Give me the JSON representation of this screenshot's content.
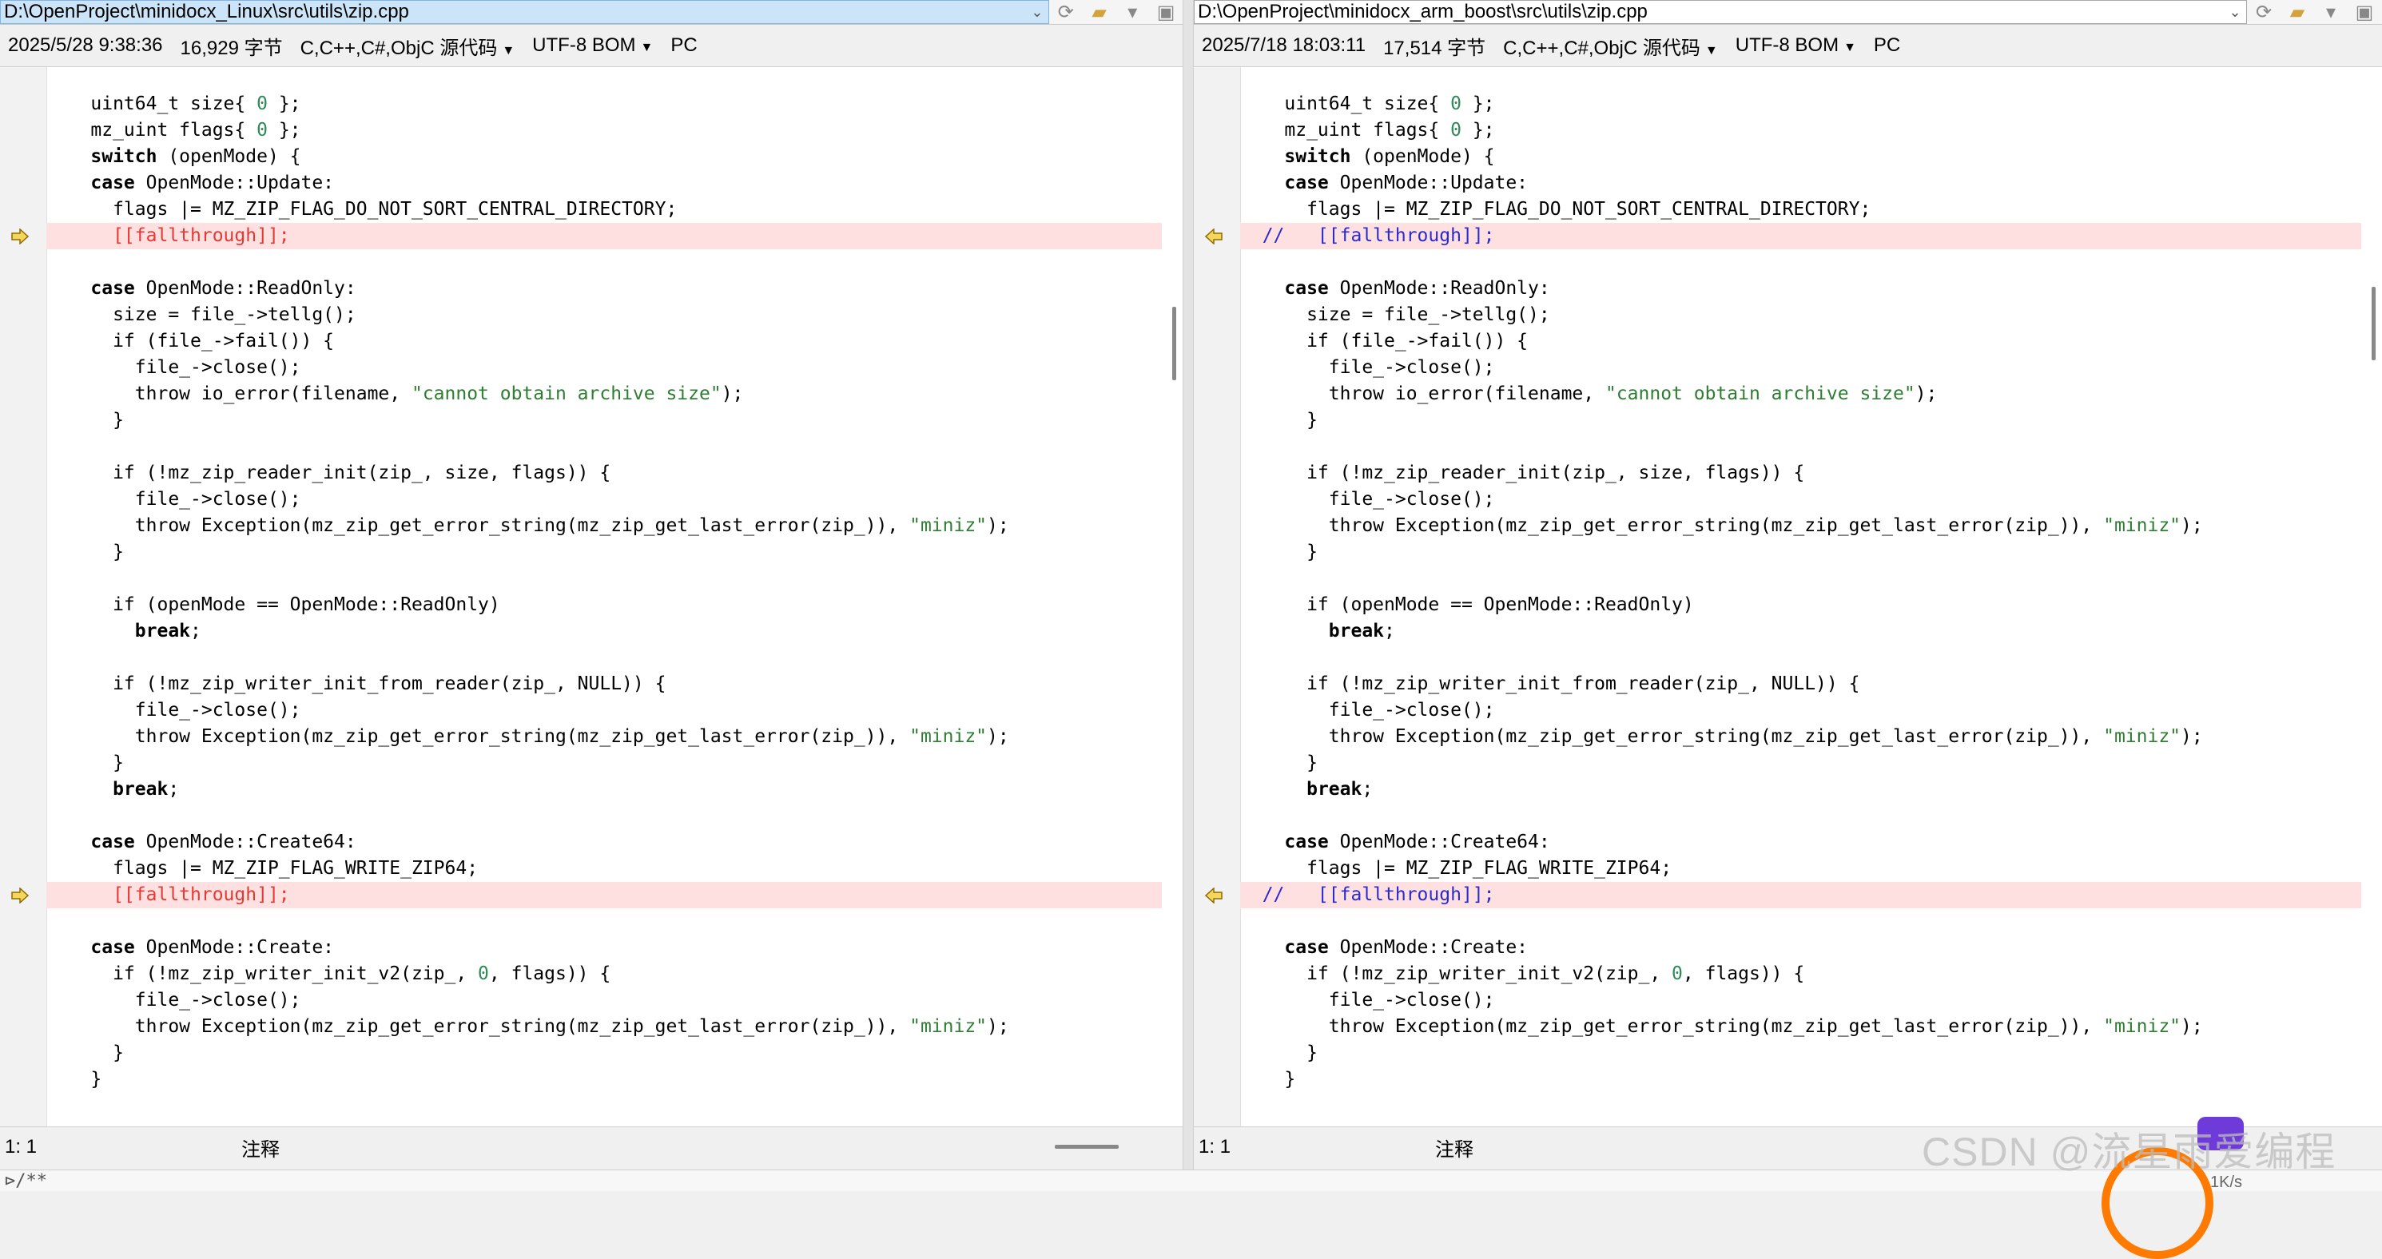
{
  "left": {
    "path": "D:\\OpenProject\\minidocx_Linux\\src\\utils\\zip.cpp",
    "timestamp": "2025/5/28 9:38:36",
    "size": "16,929 字节",
    "language": "C,C++,C#,ObjC 源代码",
    "encoding": "UTF-8 BOM",
    "line_ending": "PC",
    "position": "1: 1",
    "mode": "注释"
  },
  "right": {
    "path": "D:\\OpenProject\\minidocx_arm_boost\\src\\utils\\zip.cpp",
    "timestamp": "2025/7/18 18:03:11",
    "size": "17,514 字节",
    "language": "C,C++,C#,ObjC 源代码",
    "encoding": "UTF-8 BOM",
    "line_ending": "PC",
    "position": "1: 1",
    "mode": "注释"
  },
  "code": {
    "l01": "    uint64_t size{ ",
    "l02": "    mz_uint flags{ ",
    "l03_kw": "switch",
    "l03": " (openMode) {",
    "l04_kw": "case",
    "l04": " OpenMode::Update:",
    "l05": "      flags |= MZ_ZIP_FLAG_DO_NOT_SORT_CENTRAL_DIRECTORY;",
    "fallthrough_left": "      [[fallthrough]];",
    "fallthrough_right": "  //   [[fallthrough]];",
    "l08_kw": "case",
    "l08": " OpenMode::ReadOnly:",
    "l09": "      size = file_->tellg();",
    "l10": "      if (file_->fail()) {",
    "l11": "        file_->close();",
    "l12": "        throw io_error(filename, ",
    "l12_str": "\"cannot obtain archive size\"",
    "l12_end": ");",
    "close6": "      }",
    "l15": "      if (!mz_zip_reader_init(zip_, size, flags)) {",
    "exc": "        throw Exception(mz_zip_get_error_string(mz_zip_get_last_error(zip_)), ",
    "exc_str": "\"miniz\"",
    "exc_end": ");",
    "l19": "      if (openMode == OpenMode::ReadOnly)",
    "break": "break",
    "l22": "      if (!mz_zip_writer_init_from_reader(zip_, NULL)) {",
    "l27_kw": "case",
    "l27": " OpenMode::Create64:",
    "l28": "      flags |= MZ_ZIP_FLAG_WRITE_ZIP64;",
    "l31_kw": "case",
    "l31": " OpenMode::Create:",
    "l32a": "      if (!mz_zip_writer_init_v2(zip_, ",
    "l32b": ", flags)) {",
    "close4": "    }",
    "zero": "0",
    "close_brace_tail": " };"
  },
  "bottom_text": "/**",
  "watermark": "CSDN @流星雨爱编程",
  "tray_text": "1K/s"
}
